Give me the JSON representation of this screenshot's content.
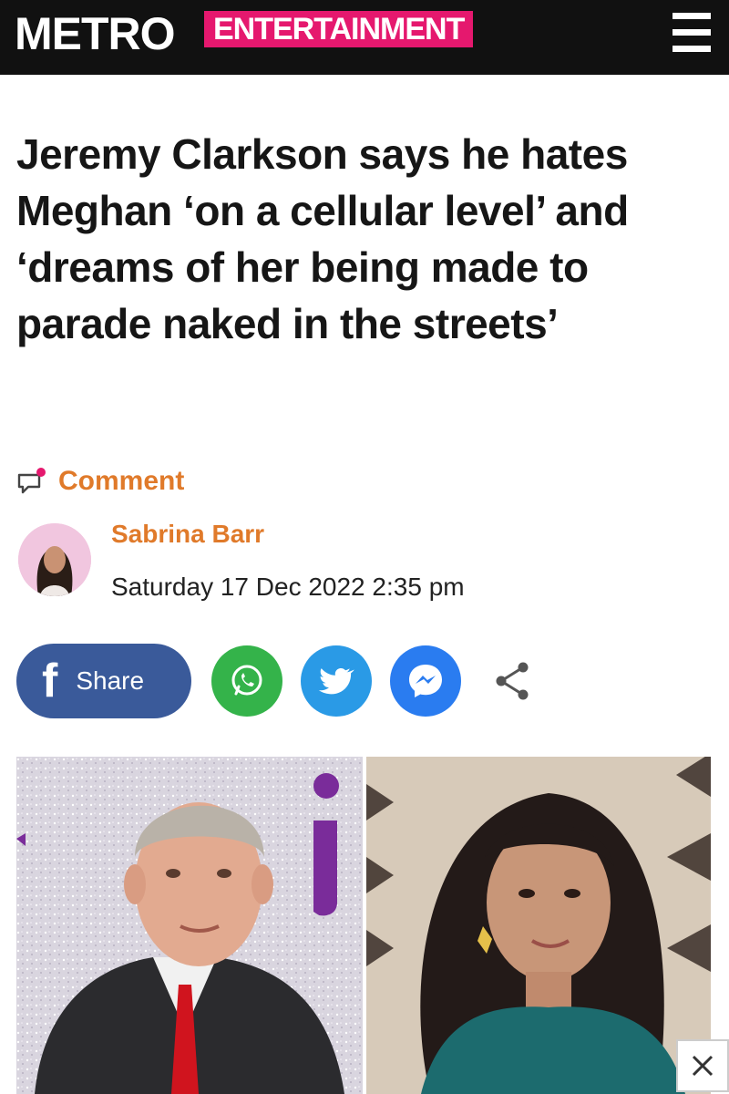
{
  "header": {
    "logo": "METRO",
    "section": "ENTERTAINMENT",
    "menu_icon": "hamburger-menu-icon"
  },
  "article": {
    "headline": "Jeremy Clarkson says he hates Meghan ‘on a cellular level’ and ‘dreams of her being made to parade naked in the streets’",
    "comment_label": "Comment",
    "author": "Sabrina Barr",
    "date": "Saturday 17 Dec 2022 2:35 pm"
  },
  "share": {
    "facebook_label": "Share",
    "icons": [
      "facebook-icon",
      "whatsapp-icon",
      "twitter-icon",
      "messenger-icon",
      "share-icon"
    ]
  },
  "colors": {
    "header_bg": "#111111",
    "section_tag": "#e5186e",
    "accent_orange": "#e07a2a",
    "facebook": "#3a5a9a",
    "whatsapp": "#34b34a",
    "twitter": "#2a9ae6",
    "messenger": "#2a7cf0"
  }
}
